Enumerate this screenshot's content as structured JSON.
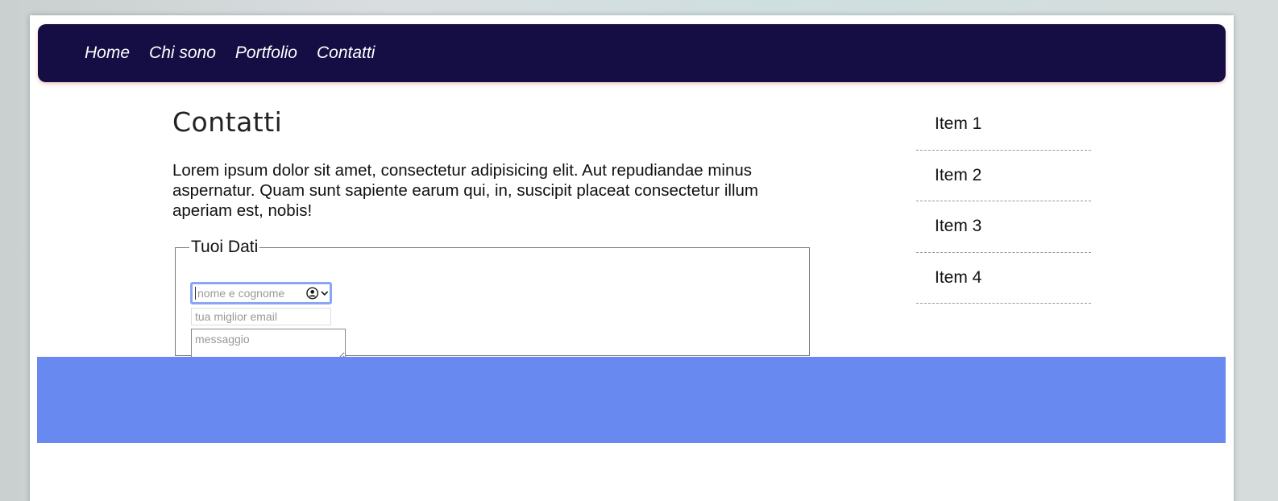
{
  "nav": {
    "items": [
      "Home",
      "Chi sono",
      "Portfolio",
      "Contatti"
    ]
  },
  "main": {
    "title": "Contatti",
    "intro": "Lorem ipsum dolor sit amet, consectetur adipisicing elit. Aut repudiandae minus aspernatur. Quam sunt sapiente earum qui, in, suscipit placeat consectetur illum aperiam est, nobis!"
  },
  "form": {
    "legend": "Tuoi Dati",
    "name_placeholder": "nome e cognome",
    "email_placeholder": "tua miglior email",
    "message_placeholder": "messaggio"
  },
  "sidebar": {
    "items": [
      "Item 1",
      "Item 2",
      "Item 3",
      "Item 4"
    ]
  },
  "colors": {
    "navbar": "#140e45",
    "footer": "#6889f0",
    "focus_ring": "#8aa6f3"
  },
  "icons": {
    "autofill": "contact-autofill-icon",
    "dropdown": "chevron-down-icon"
  }
}
